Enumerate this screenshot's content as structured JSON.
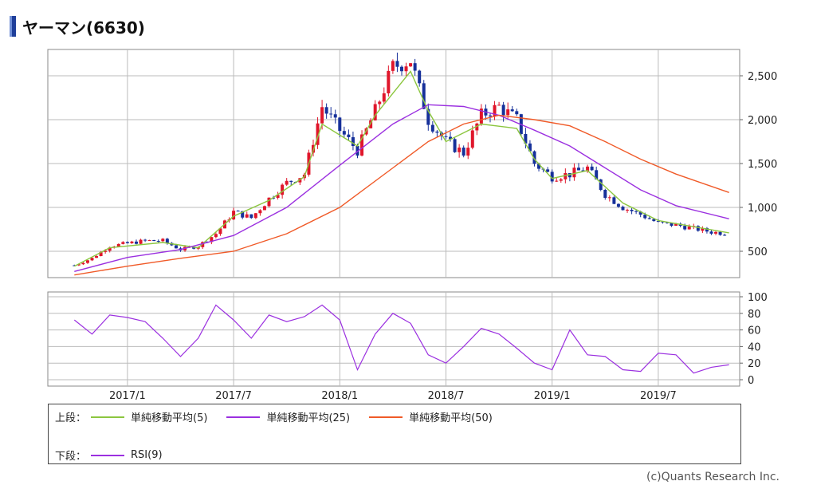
{
  "page": {
    "title": "ヤーマン(6630)",
    "credit": "(c)Quants Research Inc."
  },
  "colors": {
    "up": "#e0162b",
    "down": "#16309a",
    "ma5": "#8cc63f",
    "ma25": "#9b30e0",
    "ma50": "#f05a28",
    "rsi": "#9b30e0",
    "grid": "#bbbbbb"
  },
  "legend": {
    "upper_label": "上段：",
    "lower_label": "下段：",
    "items": [
      {
        "key": "ma5",
        "label": "単純移動平均(5)"
      },
      {
        "key": "ma25",
        "label": "単純移動平均(25)"
      },
      {
        "key": "ma50",
        "label": "単純移動平均(50)"
      }
    ],
    "lower_items": [
      {
        "key": "rsi",
        "label": "RSI(9)"
      }
    ]
  },
  "chart_data": [
    {
      "type": "candlestick",
      "y_ticks": [
        500,
        1000,
        1500,
        2000,
        2500
      ],
      "y_tick_labels": [
        "500",
        "1,000",
        "1,500",
        "2,000",
        "2,500"
      ],
      "ylim": [
        200,
        2800
      ],
      "x_tick_labels": [
        "2017/1",
        "2017/7",
        "2018/1",
        "2018/7",
        "2019/1",
        "2019/7"
      ],
      "x_tick_dates": [
        "2017-01",
        "2017-07",
        "2018-01",
        "2018-07",
        "2019-01",
        "2019-07"
      ],
      "x_start": "2016-10",
      "x_end": "2019-11",
      "weekly_close": [
        {
          "date": "2016-10",
          "v": 340
        },
        {
          "date": "2016-11",
          "v": 420
        },
        {
          "date": "2016-12",
          "v": 560
        },
        {
          "date": "2017-01",
          "v": 590
        },
        {
          "date": "2017-02",
          "v": 620
        },
        {
          "date": "2017-03",
          "v": 620
        },
        {
          "date": "2017-04",
          "v": 520
        },
        {
          "date": "2017-05",
          "v": 560
        },
        {
          "date": "2017-06",
          "v": 700
        },
        {
          "date": "2017-07",
          "v": 950
        },
        {
          "date": "2017-08",
          "v": 880
        },
        {
          "date": "2017-09",
          "v": 1100
        },
        {
          "date": "2017-10",
          "v": 1280
        },
        {
          "date": "2017-11",
          "v": 1380
        },
        {
          "date": "2017-12",
          "v": 2150
        },
        {
          "date": "2018-01",
          "v": 1880
        },
        {
          "date": "2018-02",
          "v": 1650
        },
        {
          "date": "2018-03",
          "v": 2100
        },
        {
          "date": "2018-04",
          "v": 2600
        },
        {
          "date": "2018-05",
          "v": 2680
        },
        {
          "date": "2018-06",
          "v": 2000
        },
        {
          "date": "2018-07",
          "v": 1750
        },
        {
          "date": "2018-08",
          "v": 1620
        },
        {
          "date": "2018-09",
          "v": 2050
        },
        {
          "date": "2018-10",
          "v": 2150
        },
        {
          "date": "2018-11",
          "v": 2000
        },
        {
          "date": "2018-12",
          "v": 1500
        },
        {
          "date": "2019-01",
          "v": 1350
        },
        {
          "date": "2019-02",
          "v": 1380
        },
        {
          "date": "2019-03",
          "v": 1450
        },
        {
          "date": "2019-04",
          "v": 1150
        },
        {
          "date": "2019-05",
          "v": 1000
        },
        {
          "date": "2019-06",
          "v": 920
        },
        {
          "date": "2019-07",
          "v": 820
        },
        {
          "date": "2019-08",
          "v": 800
        },
        {
          "date": "2019-09",
          "v": 760
        },
        {
          "date": "2019-10",
          "v": 720
        },
        {
          "date": "2019-11",
          "v": 700
        }
      ],
      "series": [
        {
          "name": "単純移動平均(5)",
          "key": "ma5",
          "values": [
            {
              "date": "2016-10",
              "v": 330
            },
            {
              "date": "2016-12",
              "v": 540
            },
            {
              "date": "2017-03",
              "v": 600
            },
            {
              "date": "2017-05",
              "v": 540
            },
            {
              "date": "2017-07",
              "v": 900
            },
            {
              "date": "2017-09",
              "v": 1080
            },
            {
              "date": "2017-11",
              "v": 1350
            },
            {
              "date": "2017-12",
              "v": 1950
            },
            {
              "date": "2018-02",
              "v": 1700
            },
            {
              "date": "2018-03",
              "v": 2050
            },
            {
              "date": "2018-05",
              "v": 2550
            },
            {
              "date": "2018-06",
              "v": 2100
            },
            {
              "date": "2018-07",
              "v": 1750
            },
            {
              "date": "2018-09",
              "v": 1950
            },
            {
              "date": "2018-11",
              "v": 1900
            },
            {
              "date": "2018-12",
              "v": 1550
            },
            {
              "date": "2019-01",
              "v": 1330
            },
            {
              "date": "2019-03",
              "v": 1420
            },
            {
              "date": "2019-05",
              "v": 1050
            },
            {
              "date": "2019-07",
              "v": 850
            },
            {
              "date": "2019-09",
              "v": 780
            },
            {
              "date": "2019-11",
              "v": 710
            }
          ]
        },
        {
          "name": "単純移動平均(25)",
          "key": "ma25",
          "values": [
            {
              "date": "2016-10",
              "v": 270
            },
            {
              "date": "2017-01",
              "v": 430
            },
            {
              "date": "2017-04",
              "v": 520
            },
            {
              "date": "2017-07",
              "v": 680
            },
            {
              "date": "2017-10",
              "v": 1000
            },
            {
              "date": "2018-01",
              "v": 1480
            },
            {
              "date": "2018-04",
              "v": 1950
            },
            {
              "date": "2018-06",
              "v": 2170
            },
            {
              "date": "2018-08",
              "v": 2150
            },
            {
              "date": "2018-10",
              "v": 2050
            },
            {
              "date": "2018-12",
              "v": 1880
            },
            {
              "date": "2019-02",
              "v": 1700
            },
            {
              "date": "2019-04",
              "v": 1450
            },
            {
              "date": "2019-06",
              "v": 1200
            },
            {
              "date": "2019-08",
              "v": 1020
            },
            {
              "date": "2019-11",
              "v": 870
            }
          ]
        },
        {
          "name": "単純移動平均(50)",
          "key": "ma50",
          "values": [
            {
              "date": "2016-10",
              "v": 230
            },
            {
              "date": "2017-01",
              "v": 330
            },
            {
              "date": "2017-04",
              "v": 420
            },
            {
              "date": "2017-07",
              "v": 500
            },
            {
              "date": "2017-10",
              "v": 700
            },
            {
              "date": "2018-01",
              "v": 1000
            },
            {
              "date": "2018-04",
              "v": 1450
            },
            {
              "date": "2018-06",
              "v": 1750
            },
            {
              "date": "2018-08",
              "v": 1950
            },
            {
              "date": "2018-10",
              "v": 2050
            },
            {
              "date": "2018-12",
              "v": 2000
            },
            {
              "date": "2019-02",
              "v": 1930
            },
            {
              "date": "2019-04",
              "v": 1750
            },
            {
              "date": "2019-06",
              "v": 1550
            },
            {
              "date": "2019-08",
              "v": 1380
            },
            {
              "date": "2019-11",
              "v": 1170
            }
          ]
        }
      ]
    },
    {
      "type": "line",
      "y_ticks": [
        0,
        20,
        40,
        60,
        80,
        100
      ],
      "ylim": [
        0,
        100
      ],
      "series": [
        {
          "name": "RSI(9)",
          "key": "rsi",
          "values": [
            {
              "date": "2016-10",
              "v": 72
            },
            {
              "date": "2016-11",
              "v": 55
            },
            {
              "date": "2016-12",
              "v": 78
            },
            {
              "date": "2017-01",
              "v": 75
            },
            {
              "date": "2017-02",
              "v": 70
            },
            {
              "date": "2017-03",
              "v": 50
            },
            {
              "date": "2017-04",
              "v": 28
            },
            {
              "date": "2017-05",
              "v": 50
            },
            {
              "date": "2017-06",
              "v": 90
            },
            {
              "date": "2017-07",
              "v": 72
            },
            {
              "date": "2017-08",
              "v": 50
            },
            {
              "date": "2017-09",
              "v": 78
            },
            {
              "date": "2017-10",
              "v": 70
            },
            {
              "date": "2017-11",
              "v": 76
            },
            {
              "date": "2017-12",
              "v": 90
            },
            {
              "date": "2018-01",
              "v": 72
            },
            {
              "date": "2018-02",
              "v": 12
            },
            {
              "date": "2018-03",
              "v": 55
            },
            {
              "date": "2018-04",
              "v": 80
            },
            {
              "date": "2018-05",
              "v": 68
            },
            {
              "date": "2018-06",
              "v": 30
            },
            {
              "date": "2018-07",
              "v": 20
            },
            {
              "date": "2018-08",
              "v": 40
            },
            {
              "date": "2018-09",
              "v": 62
            },
            {
              "date": "2018-10",
              "v": 55
            },
            {
              "date": "2018-11",
              "v": 38
            },
            {
              "date": "2018-12",
              "v": 20
            },
            {
              "date": "2019-01",
              "v": 12
            },
            {
              "date": "2019-02",
              "v": 60
            },
            {
              "date": "2019-03",
              "v": 30
            },
            {
              "date": "2019-04",
              "v": 28
            },
            {
              "date": "2019-05",
              "v": 12
            },
            {
              "date": "2019-06",
              "v": 10
            },
            {
              "date": "2019-07",
              "v": 32
            },
            {
              "date": "2019-08",
              "v": 30
            },
            {
              "date": "2019-09",
              "v": 8
            },
            {
              "date": "2019-10",
              "v": 15
            },
            {
              "date": "2019-11",
              "v": 18
            }
          ]
        }
      ]
    }
  ]
}
